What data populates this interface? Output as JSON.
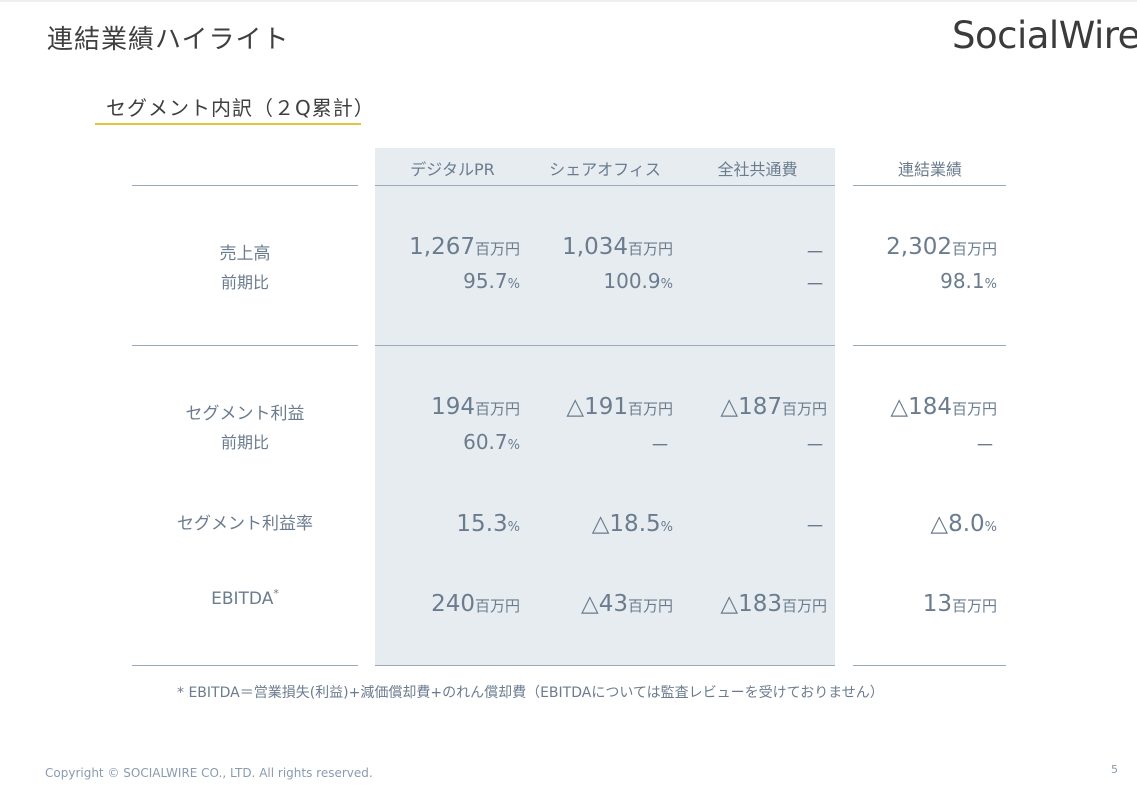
{
  "page": {
    "title": "連結業績ハイライト",
    "logo": "SocialWire",
    "subtitle": "セグメント内訳（２Q累計）",
    "footnote": "* EBITDA＝営業損失(利益)+減価償却費+のれん償却費（EBITDAについては監査レビューを受けておりません）",
    "copyright": "Copyright © SOCIALWIRE CO., LTD. All rights reserved.",
    "page_number": "5"
  },
  "table": {
    "columns": [
      "デジタルPR",
      "シェアオフィス",
      "全社共通費",
      "連結業績"
    ],
    "rows": {
      "sales_label": "売上高",
      "sales_yoy_label": "前期比",
      "profit_label": "セグメント利益",
      "profit_yoy_label": "前期比",
      "margin_label": "セグメント利益率",
      "ebitda_label": "EBITDA",
      "ebitda_mark": "*"
    },
    "unit_million": "百万円",
    "percent_unit": "%",
    "sales": {
      "digital": "1,267",
      "office": "1,034",
      "corporate": "－",
      "total": "2,302"
    },
    "sales_yoy": {
      "digital": "95.7",
      "office": "100.9",
      "corporate": "－",
      "total": "98.1"
    },
    "profit": {
      "digital": "194",
      "office": "△191",
      "corporate": "△187",
      "total": "△184"
    },
    "profit_yoy": {
      "digital": "60.7",
      "office": "－",
      "corporate": "－",
      "total": "－"
    },
    "margin": {
      "digital": "15.3",
      "office": "△18.5",
      "corporate": "－",
      "total": "△8.0"
    },
    "ebitda": {
      "digital": "240",
      "office": "△43",
      "corporate": "△183",
      "total": "13"
    }
  }
}
